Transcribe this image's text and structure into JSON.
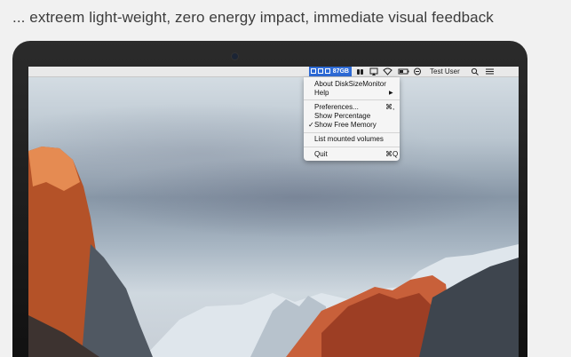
{
  "caption": "... extreem light-weight, zero energy impact, immediate visual feedback",
  "menubar": {
    "disk_size": "87GB",
    "user_name": "Test User"
  },
  "menu": {
    "about": "About DiskSizeMonitor",
    "help": "Help",
    "help_arrow": "▶",
    "preferences": "Preferences...",
    "preferences_shortcut": "⌘,",
    "show_percentage": "Show Percentage",
    "show_free_memory": "Show Free Memory",
    "checkmark": "✓",
    "list_volumes": "List mounted volumes",
    "quit": "Quit",
    "quit_shortcut": "⌘Q"
  }
}
